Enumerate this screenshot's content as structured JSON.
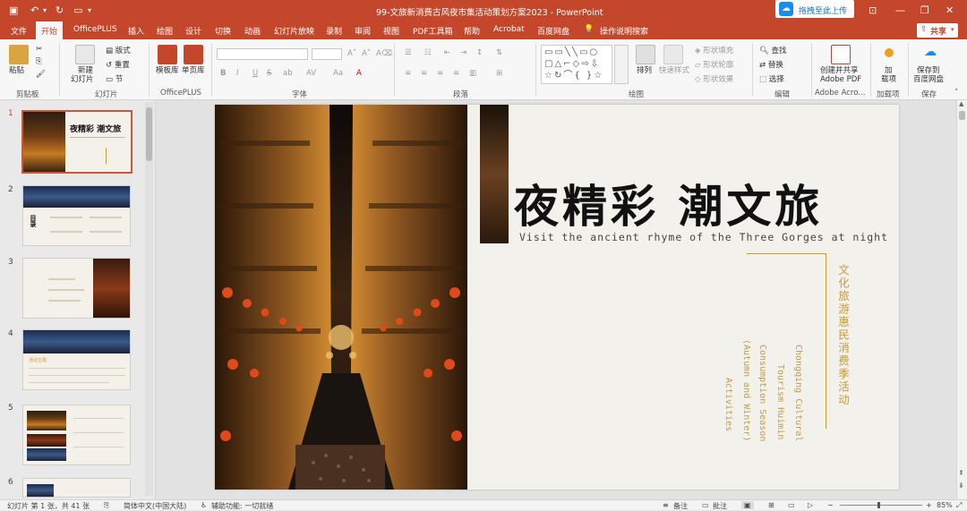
{
  "titlebar": {
    "title": "99-文旅新消费古风夜市集活动策划方案2023  -  PowerPoint",
    "upload_label": "拖拽至此上传"
  },
  "menu": {
    "items": [
      "文件",
      "开始",
      "OfficePLUS",
      "插入",
      "绘图",
      "设计",
      "切换",
      "动画",
      "幻灯片放映",
      "录制",
      "审阅",
      "视图",
      "PDF工具箱",
      "帮助",
      "Acrobat",
      "百度网盘"
    ],
    "active": "开始",
    "search_label": "操作说明搜索",
    "share_label": "共享"
  },
  "ribbon": {
    "clipboard": {
      "paste": "粘贴",
      "group": "剪贴板"
    },
    "slides": {
      "new_slide": "新建",
      "new_slide2": "幻灯片",
      "layout": "版式",
      "reset": "重置",
      "section": "节",
      "group": "幻灯片"
    },
    "officeplus": {
      "templates": "模板库",
      "single": "单页库",
      "group": "OfficePLUS"
    },
    "font": {
      "group": "字体",
      "buttons": [
        "B",
        "I",
        "U",
        "S",
        "ab",
        "AV",
        "Aa",
        "A"
      ]
    },
    "paragraph": {
      "group": "段落"
    },
    "drawing": {
      "arrange": "排列",
      "quick_styles": "快速样式",
      "fill": "形状填充",
      "outline": "形状轮廓",
      "effects": "形状效果",
      "group": "绘图"
    },
    "editing": {
      "find": "查找",
      "replace": "替换",
      "select": "选择",
      "group": "编辑"
    },
    "adobe": {
      "create_line1": "创建并共享",
      "create_line2": "Adobe PDF",
      "group": "Adobe Acro..."
    },
    "addins": {
      "line1": "加",
      "line2": "载项",
      "group": "加载项"
    },
    "save": {
      "line1": "保存到",
      "line2": "百度网盘",
      "group": "保存"
    }
  },
  "thumbnails": {
    "numbers": [
      "1",
      "2",
      "3",
      "4",
      "5",
      "6"
    ],
    "t1_title": "夜精彩 潮文旅",
    "t2_title": "目录",
    "t4_label": "活动主题"
  },
  "slide": {
    "title": "夜精彩 潮文旅",
    "subtitle": "Visit the ancient rhyme of the Three Gorges at night",
    "cn_vertical": "文化旅游惠民消费季活动",
    "en_col1": "Chongqing Cultural",
    "en_col2": "Tourism Huimin",
    "en_col3": "Consumption Season",
    "en_col4": "(Autumn and Winter)",
    "en_col5": "Activities"
  },
  "status": {
    "slide_info": "幻灯片 第 1 张，共 41 张",
    "language": "简体中文(中国大陆)",
    "accessibility": "辅助功能: 一切就绪",
    "notes": "备注",
    "comments": "批注",
    "zoom": "85%"
  },
  "colors": {
    "accent": "#c4472b",
    "gold": "#c89a3a"
  }
}
